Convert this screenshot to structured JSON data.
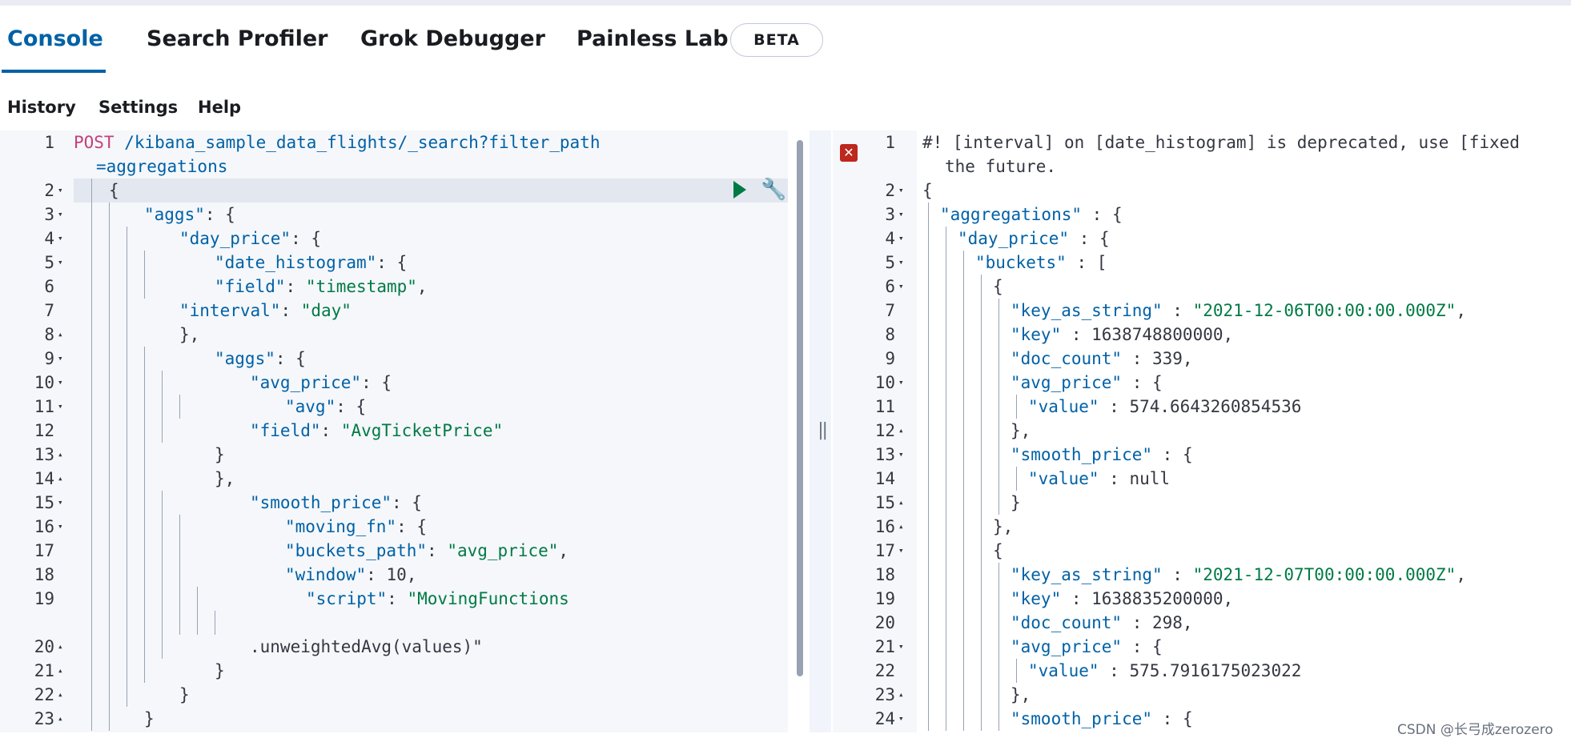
{
  "tabs": [
    {
      "label": "Console"
    },
    {
      "label": "Search Profiler"
    },
    {
      "label": "Grok Debugger"
    },
    {
      "label": "Painless Lab"
    }
  ],
  "badge": "BETA",
  "toolbar": {
    "history": "History",
    "settings": "Settings",
    "help": "Help"
  },
  "request": {
    "method": "POST",
    "path": "/kibana_sample_data_flights/_search?filter_path",
    "path_cont": "=aggregations",
    "line_numbers": [
      "1",
      "2",
      "3",
      "4",
      "5",
      "6",
      "7",
      "8",
      "9",
      "10",
      "11",
      "12",
      "13",
      "14",
      "15",
      "16",
      "17",
      "18",
      "19",
      "20",
      "21",
      "22",
      "23"
    ],
    "lines": [
      "{",
      "\"aggs\": {",
      "\"day_price\": {",
      "\"date_histogram\": {",
      "\"field\": \"timestamp\",",
      "\"interval\": \"day\"",
      "},",
      "\"aggs\": {",
      "\"avg_price\": {",
      "\"avg\": {",
      "\"field\": \"AvgTicketPrice\"",
      "}",
      "},",
      "\"smooth_price\": {",
      "\"moving_fn\": {",
      "\"buckets_path\": \"avg_price\",",
      "\"window\": 10,",
      "\"script\": \"MovingFunctions",
      ".unweightedAvg(values)\"",
      "}",
      "}",
      "}",
      "}"
    ]
  },
  "response": {
    "warning": "#! [interval] on [date_histogram] is deprecated, use [fixed",
    "warning_cont": "the future.",
    "line_numbers": [
      "1",
      "2",
      "3",
      "4",
      "5",
      "6",
      "7",
      "8",
      "9",
      "10",
      "11",
      "12",
      "13",
      "14",
      "15",
      "16",
      "17",
      "18",
      "19",
      "20",
      "21",
      "22",
      "23",
      "24"
    ],
    "lines": [
      "{",
      "\"aggregations\" : {",
      "\"day_price\" : {",
      "\"buckets\" : [",
      "{",
      "\"key_as_string\" : \"2021-12-06T00:00:00.000Z\",",
      "\"key\" : 1638748800000,",
      "\"doc_count\" : 339,",
      "\"avg_price\" : {",
      "\"value\" : 574.6643260854536",
      "},",
      "\"smooth_price\" : {",
      "\"value\" : null",
      "}",
      "},",
      "{",
      "\"key_as_string\" : \"2021-12-07T00:00:00.000Z\",",
      "\"key\" : 1638835200000,",
      "\"doc_count\" : 298,",
      "\"avg_price\" : {",
      "\"value\" : 575.7916175023022",
      "},",
      "\"smooth_price\" : {"
    ]
  },
  "watermark": "CSDN @长弓成zerozero",
  "colors": {
    "accent": "#0061a6",
    "string": "#007a45",
    "method": "#c4407c",
    "error": "#bd271e"
  },
  "icons": [
    "play-icon",
    "wrench-icon",
    "error-icon",
    "drag-handle-icon"
  ]
}
